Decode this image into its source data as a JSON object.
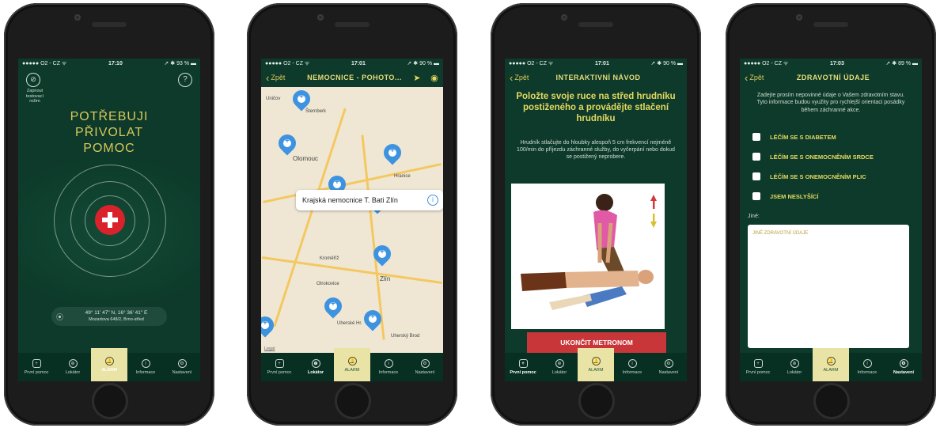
{
  "phones": [
    {
      "status": {
        "carrier": "●●●●● O2 - CZ ᯤ",
        "time": "17:10",
        "battery": "➚ ✱ 93 % ▬"
      },
      "test_mode_label": "Zapnout testovací režim",
      "help_label": "?",
      "headline": "POTŘEBUJI PŘIVOLAT POMOC",
      "location": {
        "coords": "49° 11' 47\" N, 16° 36' 41\" E",
        "address": "Mozartova 648/2, Brno-střed"
      }
    },
    {
      "status": {
        "carrier": "●●●●● O2 - CZ ᯤ",
        "time": "17:01",
        "battery": "➚ ✱ 90 % ▬"
      },
      "back_label": "Zpět",
      "title": "NEMOCNICE - POHOTO...",
      "towns": [
        "Uničov",
        "Šternberk",
        "Olomouc",
        "Hranice",
        "Kroměříž",
        "Otrokovice",
        "Zlín",
        "Uherské Hr.",
        "Uherský Brod"
      ],
      "callout": "Krajská nemocnice T. Bati Zlín",
      "legal": "Legal"
    },
    {
      "status": {
        "carrier": "●●●●● O2 - CZ ᯤ",
        "time": "17:01",
        "battery": "➚ ✱ 90 % ▬"
      },
      "back_label": "Zpět",
      "title": "INTERAKTIVNÍ NÁVOD",
      "headline": "Položte svoje ruce na střed hrudníku postiženého a provádějte stlačení hrudníku",
      "description": "Hrudník stlačujte do hloubky alespoň 5 cm frekvencí nejméně 100/min do příjezdu záchranné služby, do vyčerpání nebo dokud se postižený neprobere.",
      "stop_button": "UKONČIT METRONOM"
    },
    {
      "status": {
        "carrier": "●●●●● O2 - CZ ᯤ",
        "time": "17:03",
        "battery": "➚ ✱ 89 % ▬"
      },
      "back_label": "Zpět",
      "title": "ZDRAVOTNÍ ÚDAJE",
      "intro": "Zadejte prosím nepovinné údaje o Vašem zdravotním stavu. Tyto informace budou využity pro rychlejší orientaci posádky během záchranné akce.",
      "checks": [
        "LÉČÍM SE S DIABETEM",
        "LÉČÍM SE S ONEMOCNĚNÍM SRDCE",
        "LÉČÍM SE S ONEMOCNĚNÍM PLIC",
        "JSEM NESLYŠÍCÍ"
      ],
      "other_label": "Jiné:",
      "other_placeholder": "JINÉ ZDRAVOTNÍ ÚDAJE"
    }
  ],
  "tabs": {
    "first_aid": "První pomoc",
    "locator": "Lokátor",
    "alarm": "ALARM",
    "info": "Informace",
    "settings": "Nastavení"
  },
  "colors": {
    "background": "#0d3a2a",
    "accent": "#d8c85a",
    "alarm_tab": "#e9e3a6",
    "danger": "#d9222b",
    "pin": "#3e93e0"
  }
}
